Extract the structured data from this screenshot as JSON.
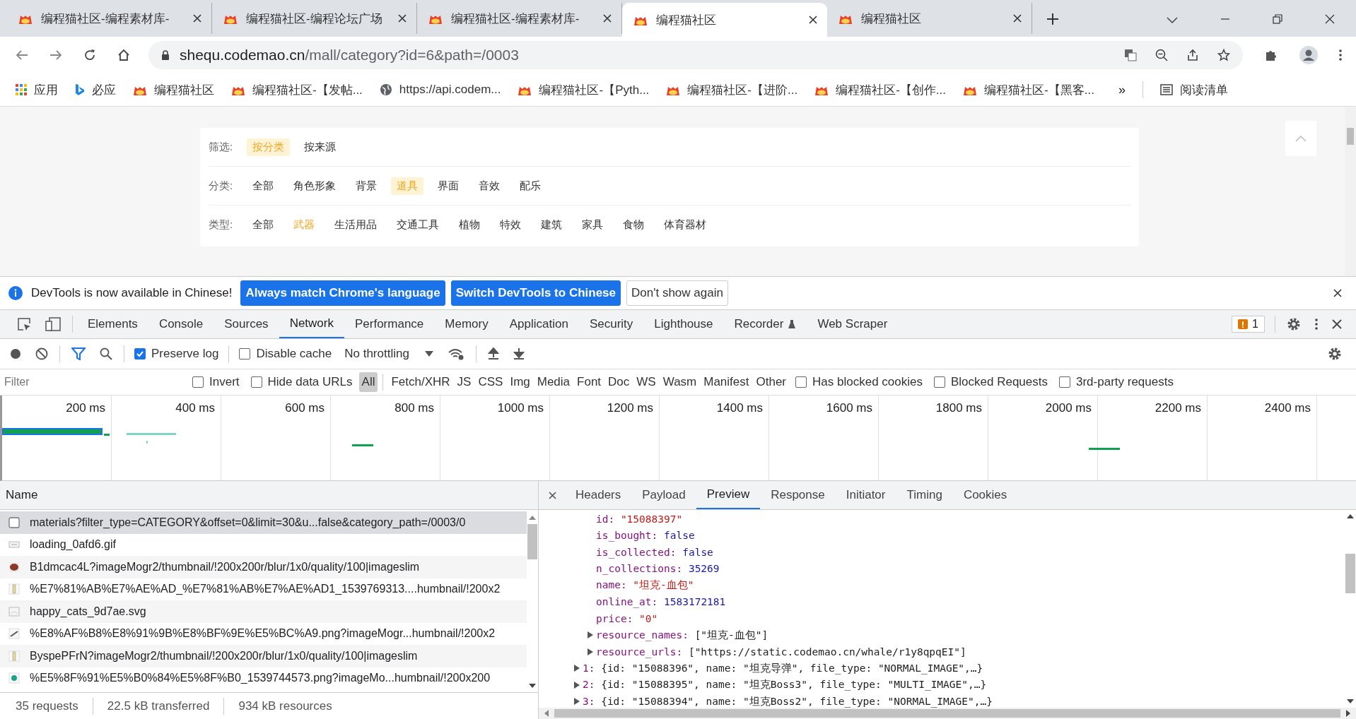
{
  "browser": {
    "tabs": [
      {
        "title": "编程猫社区-编程素材库-",
        "selected": false
      },
      {
        "title": "编程猫社区-编程论坛广场",
        "selected": false
      },
      {
        "title": "编程猫社区-编程素材库-",
        "selected": false
      },
      {
        "title": "编程猫社区",
        "selected": true
      },
      {
        "title": "编程猫社区",
        "selected": false
      }
    ],
    "url_host": "shequ.codemao.cn",
    "url_path": "/mall/category?id=6&path=/0003",
    "bookmarks": [
      {
        "kind": "apps",
        "label": "应用"
      },
      {
        "kind": "bing",
        "label": "必应"
      },
      {
        "kind": "site",
        "label": "编程猫社区"
      },
      {
        "kind": "site",
        "label": "编程猫社区-【发帖..."
      },
      {
        "kind": "globe",
        "label": "https://api.codem..."
      },
      {
        "kind": "site",
        "label": "编程猫社区-【Pyth..."
      },
      {
        "kind": "site",
        "label": "编程猫社区-【进阶..."
      },
      {
        "kind": "site",
        "label": "编程猫社区-【创作..."
      },
      {
        "kind": "site",
        "label": "编程猫社区-【黑客..."
      }
    ],
    "overflow": "»",
    "reading_list": "阅读清单"
  },
  "page": {
    "filters": [
      {
        "label": "筛选:",
        "kind": "pills",
        "options": [
          {
            "text": "按分类",
            "selected": true
          },
          {
            "text": "按来源",
            "selected": false
          }
        ]
      },
      {
        "label": "分类:",
        "kind": "pills",
        "options": [
          {
            "text": "全部",
            "selected": false
          },
          {
            "text": "角色形象",
            "selected": false
          },
          {
            "text": "背景",
            "selected": false
          },
          {
            "text": "道具",
            "selected": true
          },
          {
            "text": "界面",
            "selected": false
          },
          {
            "text": "音效",
            "selected": false
          },
          {
            "text": "配乐",
            "selected": false
          }
        ]
      },
      {
        "label": "类型:",
        "kind": "links",
        "options": [
          {
            "text": "全部",
            "selected": false
          },
          {
            "text": "武器",
            "selected": true
          },
          {
            "text": "生活用品",
            "selected": false
          },
          {
            "text": "交通工具",
            "selected": false
          },
          {
            "text": "植物",
            "selected": false
          },
          {
            "text": "特效",
            "selected": false
          },
          {
            "text": "建筑",
            "selected": false
          },
          {
            "text": "家具",
            "selected": false
          },
          {
            "text": "食物",
            "selected": false
          },
          {
            "text": "体育器材",
            "selected": false
          }
        ]
      }
    ]
  },
  "devtools": {
    "infobar": {
      "message": "DevTools is now available in Chinese!",
      "buttons": [
        {
          "text": "Always match Chrome's language",
          "kind": "primary"
        },
        {
          "text": "Switch DevTools to Chinese",
          "kind": "primary"
        },
        {
          "text": "Don't show again",
          "kind": "secondary"
        }
      ]
    },
    "tabs": [
      {
        "label": "Elements",
        "selected": false
      },
      {
        "label": "Console",
        "selected": false
      },
      {
        "label": "Sources",
        "selected": false
      },
      {
        "label": "Network",
        "selected": true
      },
      {
        "label": "Performance",
        "selected": false
      },
      {
        "label": "Memory",
        "selected": false
      },
      {
        "label": "Application",
        "selected": false
      },
      {
        "label": "Security",
        "selected": false
      },
      {
        "label": "Lighthouse",
        "selected": false
      },
      {
        "label": "Recorder",
        "selected": false
      },
      {
        "label": "Web Scraper",
        "selected": false
      }
    ],
    "issues": "1",
    "toolbar": {
      "preserve_log": {
        "label": "Preserve log",
        "checked": true
      },
      "disable_cache": {
        "label": "Disable cache",
        "checked": false
      },
      "throttling": "No throttling"
    },
    "filter_bar": {
      "placeholder": "Filter",
      "invert": {
        "label": "Invert",
        "checked": false
      },
      "hide_data_urls": {
        "label": "Hide data URLs",
        "checked": false
      },
      "types": [
        {
          "label": "All",
          "selected": true
        },
        {
          "label": "Fetch/XHR",
          "selected": false
        },
        {
          "label": "JS",
          "selected": false
        },
        {
          "label": "CSS",
          "selected": false
        },
        {
          "label": "Img",
          "selected": false
        },
        {
          "label": "Media",
          "selected": false
        },
        {
          "label": "Font",
          "selected": false
        },
        {
          "label": "Doc",
          "selected": false
        },
        {
          "label": "WS",
          "selected": false
        },
        {
          "label": "Wasm",
          "selected": false
        },
        {
          "label": "Manifest",
          "selected": false
        },
        {
          "label": "Other",
          "selected": false
        }
      ],
      "options": [
        {
          "label": "Has blocked cookies",
          "checked": false
        },
        {
          "label": "Blocked Requests",
          "checked": false
        },
        {
          "label": "3rd-party requests",
          "checked": false
        }
      ]
    },
    "timeline_ticks": [
      "200 ms",
      "400 ms",
      "600 ms",
      "800 ms",
      "1000 ms",
      "1200 ms",
      "1400 ms",
      "1600 ms",
      "1800 ms",
      "2000 ms",
      "2200 ms",
      "2400 ms"
    ],
    "requests": {
      "column": "Name",
      "rows": [
        {
          "name": "materials?filter_type=CATEGORY&offset=0&limit=30&u...false&category_path=/0003/0",
          "kind": "fetch",
          "selected": true
        },
        {
          "name": "loading_0afd6.gif",
          "kind": "gif",
          "selected": false
        },
        {
          "name": "B1dmcac4L?imageMogr2/thumbnail/!200x200r/blur/1x0/quality/100|imageslim",
          "kind": "round",
          "selected": false
        },
        {
          "name": "%E7%81%AB%E7%AE%AD_%E7%81%AB%E7%AE%AD1_1539769313....humbnail/!200x2",
          "kind": "tall",
          "selected": false
        },
        {
          "name": "happy_cats_9d7ae.svg",
          "kind": "svg",
          "selected": false
        },
        {
          "name": "%E8%AF%B8%E8%91%9B%E8%BF%9E%E5%BC%A9.png?imageMogr...humbnail/!200x2",
          "kind": "diag",
          "selected": false
        },
        {
          "name": "ByspePFrN?imageMogr2/thumbnail/!200x200r/blur/1x0/quality/100|imageslim",
          "kind": "tall",
          "selected": false
        },
        {
          "name": "%E5%8F%91%E5%B0%84%E5%8F%B0_1539744573.png?imageMo...humbnail/!200x200",
          "kind": "dot",
          "selected": false
        }
      ]
    },
    "detail_tabs": [
      {
        "label": "Headers",
        "selected": false
      },
      {
        "label": "Payload",
        "selected": false
      },
      {
        "label": "Preview",
        "selected": true
      },
      {
        "label": "Response",
        "selected": false
      },
      {
        "label": "Initiator",
        "selected": false
      },
      {
        "label": "Timing",
        "selected": false
      },
      {
        "label": "Cookies",
        "selected": false
      }
    ],
    "preview": {
      "fields": [
        {
          "key": "id:",
          "value": "\"15088397\"",
          "kind": "string"
        },
        {
          "key": "is_bought:",
          "value": "false",
          "kind": "literal"
        },
        {
          "key": "is_collected:",
          "value": "false",
          "kind": "literal"
        },
        {
          "key": "n_collections:",
          "value": "35269",
          "kind": "literal"
        },
        {
          "key": "name:",
          "value": "\"坦克-血包\"",
          "kind": "string"
        },
        {
          "key": "online_at:",
          "value": "1583172181",
          "kind": "literal"
        },
        {
          "key": "price:",
          "value": "\"0\"",
          "kind": "string"
        },
        {
          "key": "resource_names:",
          "value": "[\"坦克-血包\"]",
          "kind": "array",
          "expanded": false
        },
        {
          "key": "resource_urls:",
          "value": "[\"https://static.codemao.cn/whale/r1y8qpqEI\"]",
          "kind": "array",
          "expanded": false
        }
      ],
      "items": [
        {
          "key": "1:",
          "value": "{id: \"15088396\", name: \"坦克导弹\", file_type: \"NORMAL_IMAGE\",…}",
          "expanded": false
        },
        {
          "key": "2:",
          "value": "{id: \"15088395\", name: \"坦克Boss3\", file_type: \"MULTI_IMAGE\",…}",
          "expanded": false
        },
        {
          "key": "3:",
          "value": "{id: \"15088394\", name: \"坦克Boss2\", file_type: \"NORMAL_IMAGE\",…}",
          "expanded": false
        }
      ]
    },
    "status": [
      "35 requests",
      "22.5 kB transferred",
      "934 kB resources"
    ]
  }
}
